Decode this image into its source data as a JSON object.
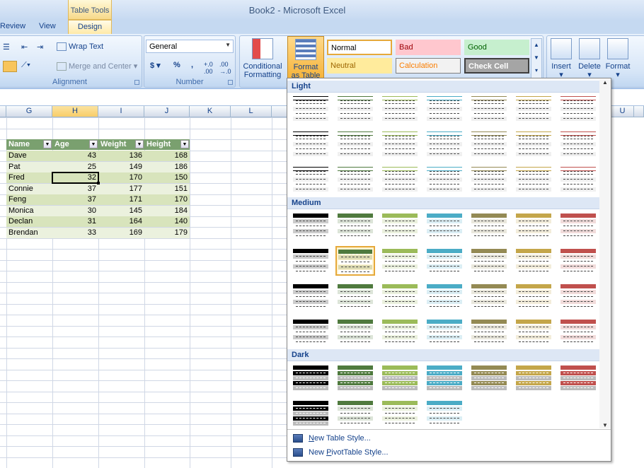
{
  "window": {
    "title": "Book2 - Microsoft Excel"
  },
  "contextual": {
    "label": "Table Tools",
    "tab": "Design"
  },
  "tabs": [
    "Review",
    "View"
  ],
  "ribbon": {
    "alignment": {
      "label": "Alignment",
      "wrap_text": "Wrap Text",
      "merge": "Merge and Center"
    },
    "number": {
      "label": "Number",
      "format_value": "General",
      "currency": "$",
      "percent": "%",
      "comma": ","
    },
    "styles": {
      "conditional": "Conditional",
      "conditional2": "Formatting",
      "format_table": "Format",
      "format_table2": "as Table",
      "cell_styles": [
        {
          "name": "Normal",
          "bg": "#ffffff",
          "fg": "#000000",
          "border": "#e6a93a"
        },
        {
          "name": "Bad",
          "bg": "#ffc7ce",
          "fg": "#9c0006",
          "border": "#ffc7ce"
        },
        {
          "name": "Good",
          "bg": "#c6efce",
          "fg": "#006100",
          "border": "#c6efce"
        },
        {
          "name": "Neutral",
          "bg": "#ffeb9c",
          "fg": "#9c6500",
          "border": "#ffeb9c"
        },
        {
          "name": "Calculation",
          "bg": "#f2f2f2",
          "fg": "#fa7d00",
          "border": "#7f7f7f"
        },
        {
          "name": "Check Cell",
          "bg": "#a5a5a5",
          "fg": "#ffffff",
          "border": "#3f3f3f"
        }
      ]
    },
    "cells": {
      "insert": "Insert",
      "delete": "Delete",
      "format": "Format"
    }
  },
  "columns": [
    "G",
    "H",
    "I",
    "J",
    "K",
    "L",
    "U"
  ],
  "table": {
    "headers": [
      "Name",
      "Age",
      "Weight",
      "Height"
    ],
    "rows": [
      [
        "Dave",
        "43",
        "136",
        "168"
      ],
      [
        "Pat",
        "25",
        "149",
        "186"
      ],
      [
        "Fred",
        "32",
        "170",
        "150"
      ],
      [
        "Connie",
        "37",
        "177",
        "151"
      ],
      [
        "Feng",
        "37",
        "171",
        "170"
      ],
      [
        "Monica",
        "30",
        "145",
        "184"
      ],
      [
        "Declan",
        "31",
        "164",
        "140"
      ],
      [
        "Brendan",
        "33",
        "169",
        "179"
      ]
    ]
  },
  "gallery": {
    "sections": [
      "Light",
      "Medium",
      "Dark"
    ],
    "palette": [
      "#000000",
      "#4f7a3e",
      "#9bbb59",
      "#4bacc6",
      "#948a54",
      "#c4a64a",
      "#c0504d"
    ],
    "menu": [
      {
        "prefix": "",
        "ul": "N",
        "rest": "ew Table Style..."
      },
      {
        "prefix": "New ",
        "ul": "P",
        "rest": "ivotTable Style..."
      }
    ]
  }
}
